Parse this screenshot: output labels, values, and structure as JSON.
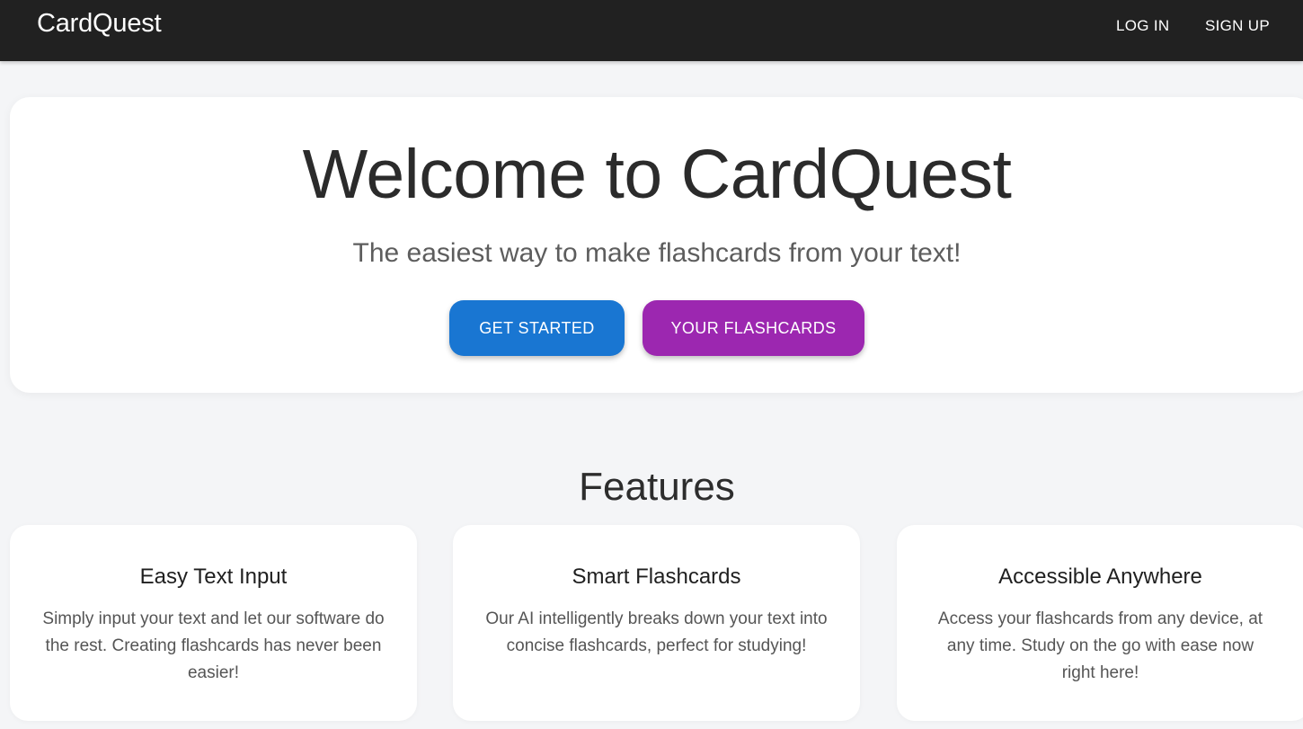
{
  "appbar": {
    "brand": "CardQuest",
    "nav": [
      {
        "label": "LOG IN"
      },
      {
        "label": "SIGN UP"
      }
    ]
  },
  "hero": {
    "title": "Welcome to CardQuest",
    "subtitle": "The easiest way to make flashcards from your text!",
    "primary_button": "GET STARTED",
    "secondary_button": "YOUR FLASHCARDS"
  },
  "features": {
    "heading": "Features",
    "items": [
      {
        "title": "Easy Text Input",
        "description": "Simply input your text and let our software do the rest. Creating flashcards has never been easier!"
      },
      {
        "title": "Smart Flashcards",
        "description": "Our AI intelligently breaks down your text into concise flashcards, perfect for studying!"
      },
      {
        "title": "Accessible Anywhere",
        "description": "Access your flashcards from any device, at any time. Study on the go with ease now right here!"
      }
    ]
  },
  "colors": {
    "appbar": "#212121",
    "background": "#f4f5f7",
    "primary": "#1976d2",
    "secondary": "#9c27b0"
  }
}
